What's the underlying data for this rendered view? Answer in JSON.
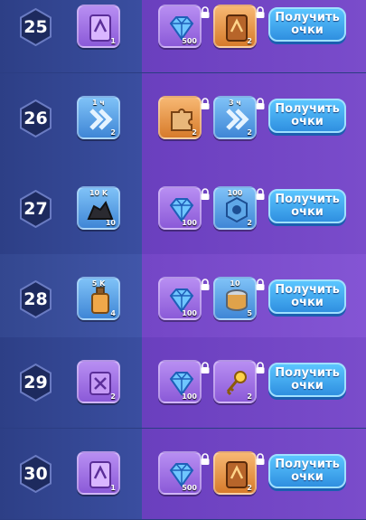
{
  "button_label": "Получить очки",
  "rows": [
    {
      "level": "25",
      "free": {
        "icon": "purple-book-icon",
        "count": "1"
      },
      "premium": [
        {
          "icon": "blue-diamond-icon",
          "count": "500",
          "top": ""
        },
        {
          "icon": "orange-book-icon",
          "count": "2",
          "top": ""
        }
      ]
    },
    {
      "level": "26",
      "free": {
        "icon": "speed-up-icon",
        "count": "2",
        "top": "1 ч"
      },
      "premium": [
        {
          "icon": "puzzle-piece-icon",
          "count": "2",
          "top": ""
        },
        {
          "icon": "speed-up-icon",
          "count": "2",
          "top": "3 ч"
        }
      ]
    },
    {
      "level": "27",
      "free": {
        "icon": "coal-pile-icon",
        "count": "10",
        "top": "10 K"
      },
      "premium": [
        {
          "icon": "blue-diamond-icon",
          "count": "100",
          "top": ""
        },
        {
          "icon": "steel-nut-icon",
          "count": "2",
          "top": "100"
        }
      ]
    },
    {
      "level": "28",
      "free": {
        "icon": "oil-bottle-icon",
        "count": "4",
        "top": "5 K"
      },
      "premium": [
        {
          "icon": "blue-diamond-icon",
          "count": "100",
          "top": ""
        },
        {
          "icon": "food-can-icon",
          "count": "5",
          "top": "10"
        }
      ]
    },
    {
      "level": "29",
      "free": {
        "icon": "purple-scroll-icon",
        "count": "2",
        "top": ""
      },
      "premium": [
        {
          "icon": "blue-diamond-icon",
          "count": "100",
          "top": ""
        },
        {
          "icon": "golden-key-icon",
          "count": "2",
          "top": ""
        }
      ]
    },
    {
      "level": "30",
      "free": {
        "icon": "purple-book-icon",
        "count": "1",
        "top": ""
      },
      "premium": [
        {
          "icon": "blue-diamond-icon",
          "count": "500",
          "top": ""
        },
        {
          "icon": "orange-book-icon",
          "count": "2",
          "top": ""
        }
      ]
    }
  ]
}
